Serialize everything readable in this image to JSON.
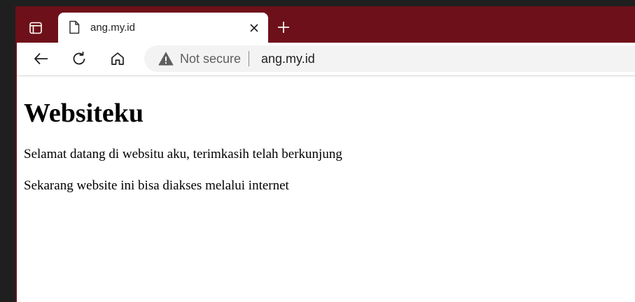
{
  "tab": {
    "title": "ang.my.id"
  },
  "toolbar": {
    "security_label": "Not secure",
    "url": "ang.my.id"
  },
  "page": {
    "heading": "Websiteku",
    "paragraphs": [
      "Selamat datang di websitu aku, terimkasih telah berkunjung",
      "Sekarang website ini bisa diakses melalui internet"
    ]
  },
  "colors": {
    "tabstrip_bg": "#6e1019",
    "page_bg": "#ffffff"
  },
  "icons": [
    "tab-actions-icon",
    "page-favicon-icon",
    "close-icon",
    "plus-icon",
    "back-arrow-icon",
    "reload-icon",
    "home-icon",
    "warning-icon"
  ]
}
